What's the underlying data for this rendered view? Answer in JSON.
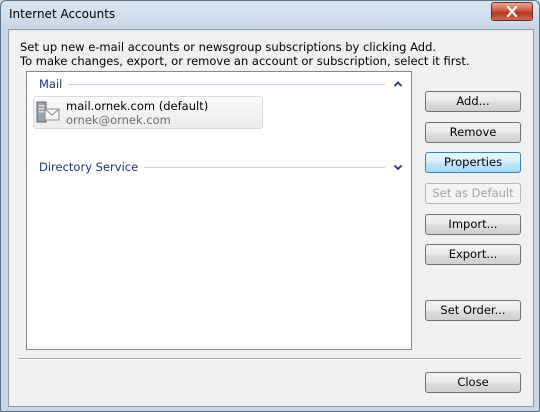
{
  "window": {
    "title": "Internet Accounts"
  },
  "intro": {
    "line1": "Set up new e-mail accounts or newsgroup subscriptions by clicking Add.",
    "line2": "To make changes, export, or remove an account or subscription, select it first."
  },
  "groups": {
    "mail": {
      "label": "Mail",
      "account": {
        "name": "mail.ornek.com (default)",
        "email": "ornek@ornek.com"
      }
    },
    "directory": {
      "label": "Directory Service"
    }
  },
  "buttons": {
    "add": "Add...",
    "remove": "Remove",
    "properties": "Properties",
    "set_default": "Set as Default",
    "import": "Import...",
    "export": "Export...",
    "set_order": "Set Order...",
    "close": "Close"
  },
  "icons": {
    "window_close": "close-icon",
    "mail_group_toggle": "chevron-up-icon",
    "directory_group_toggle": "chevron-down-icon",
    "account": "mail-server-icon"
  },
  "colors": {
    "group_label": "#1e3287",
    "close_button": "#c8402b",
    "focused_button": "#bee6fd"
  }
}
